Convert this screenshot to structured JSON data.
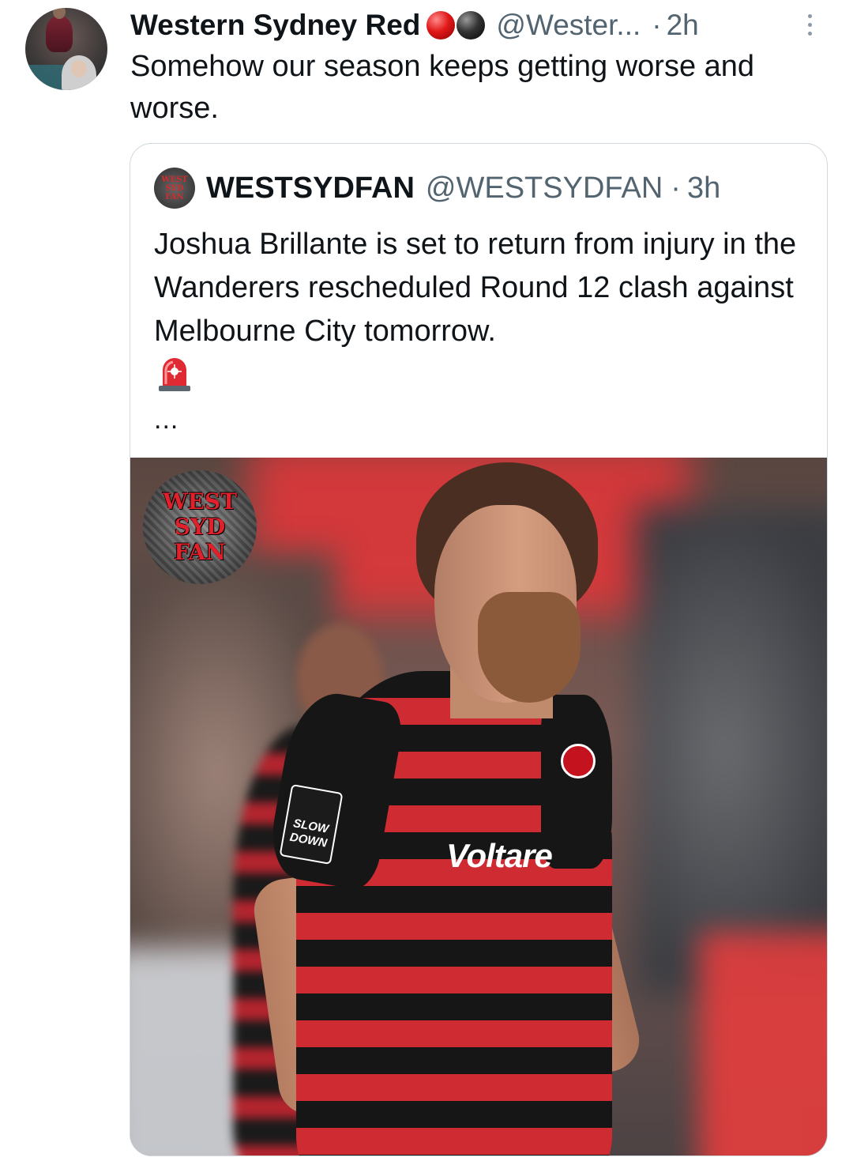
{
  "tweet": {
    "author_name": "Western Sydney Red",
    "author_emoji": [
      "red-ball",
      "black-ball"
    ],
    "handle": "@Wester...",
    "separator": "·",
    "time": "2h",
    "text": "Somehow our season keeps getting worse and worse."
  },
  "quoted_tweet": {
    "author_name": "WESTSYDFAN",
    "handle": "@WESTSYDFAN",
    "separator": "·",
    "time": "3h",
    "text": "Joshua Brillante is set to return from injury in the Wanderers rescheduled Round 12 clash against Melbourne City tomorrow.",
    "emoji": "siren-icon",
    "truncation": "...",
    "avatar_text": "WEST SYD FAN",
    "media": {
      "watermark_lines": [
        "WEST",
        "SYD",
        "FAN"
      ],
      "jersey_sponsor": "Voltare",
      "sleeve_patch_lines": [
        "SLOW",
        "DOWN"
      ]
    }
  },
  "colors": {
    "primary_text": "#0f1419",
    "secondary_text": "#536471",
    "border": "#cfd9de",
    "jersey_red": "#cf2b33",
    "jersey_black": "#161616"
  }
}
